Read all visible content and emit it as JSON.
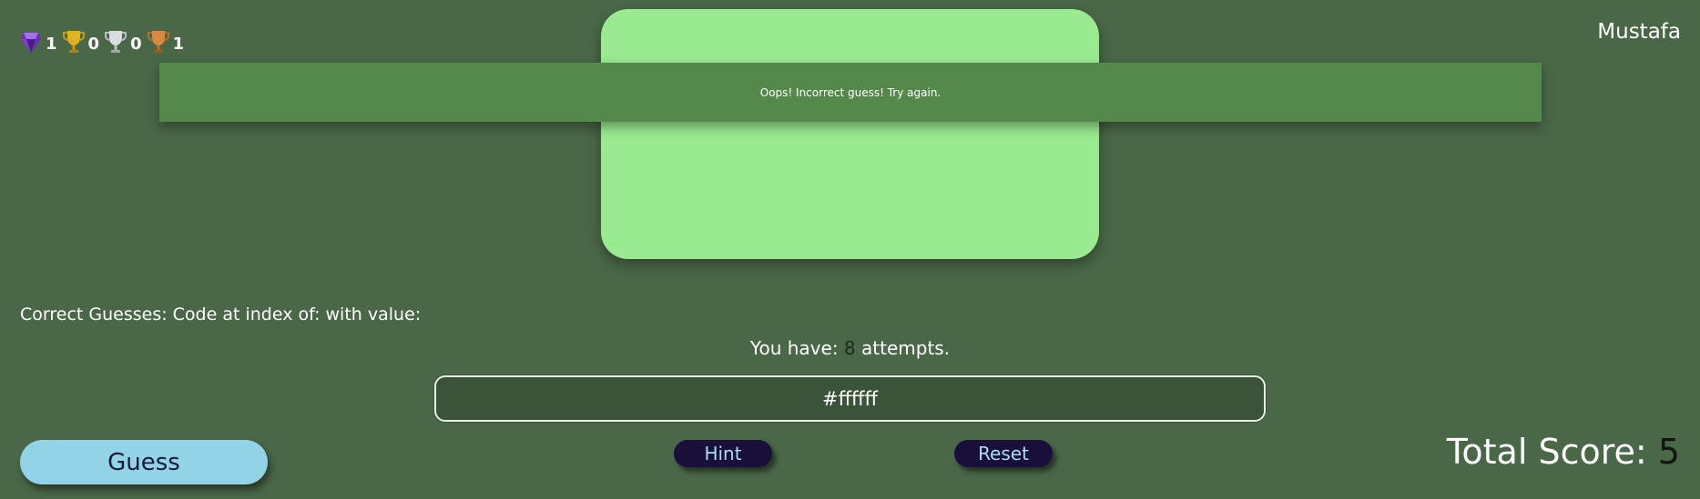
{
  "stats": [
    {
      "icon": "gem-icon",
      "count": "1"
    },
    {
      "icon": "gold-trophy-icon",
      "count": "0"
    },
    {
      "icon": "silver-trophy-icon",
      "count": "0"
    },
    {
      "icon": "bronze-trophy-icon",
      "count": "1"
    }
  ],
  "user": {
    "name": "Mustafa"
  },
  "swatch": {
    "color": "#9aea90"
  },
  "banner": {
    "message": "Oops! Incorrect guess! Try again."
  },
  "correct": {
    "label": "Correct Guesses:",
    "code_label": "Code at index of:",
    "value_label": "with value:"
  },
  "attempts": {
    "prefix": "You have:",
    "count": "8",
    "suffix": "attempts."
  },
  "input": {
    "value": "#ffffff"
  },
  "buttons": {
    "guess": "Guess",
    "hint": "Hint",
    "reset": "Reset"
  },
  "score": {
    "label": "Total Score:",
    "value": "5"
  },
  "colors": {
    "background": "#4a6748",
    "banner": "#55894c",
    "guess_button": "#93d3e8",
    "small_button": "#1a0f3b"
  }
}
